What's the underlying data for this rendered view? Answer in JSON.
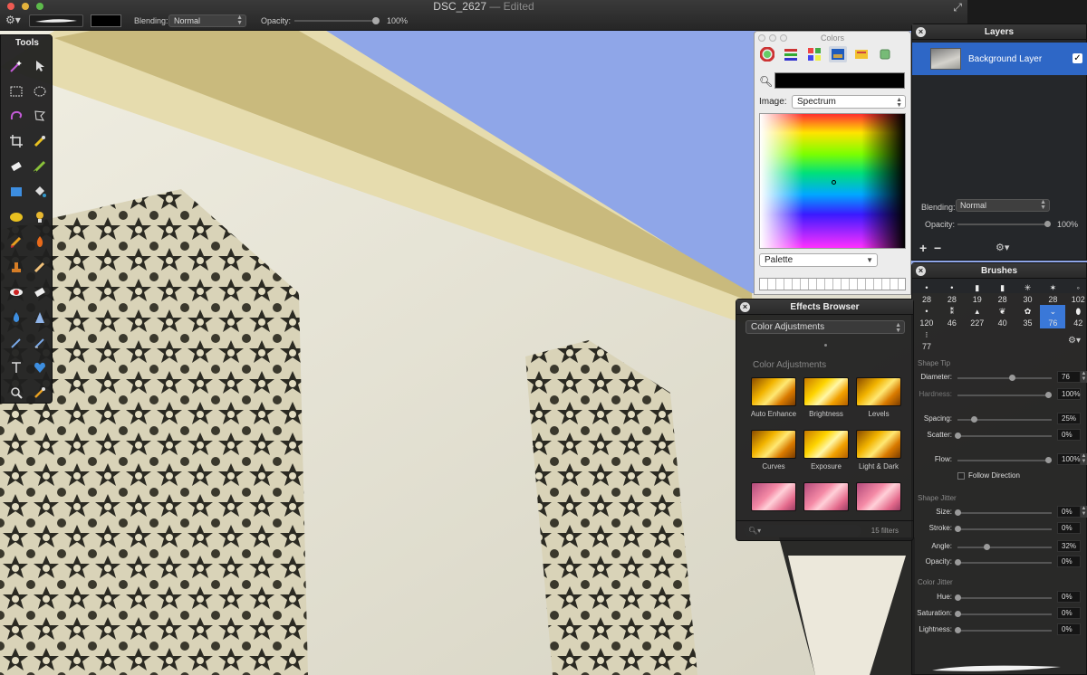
{
  "window": {
    "title": "DSC_2627",
    "edited": "— Edited"
  },
  "options_bar": {
    "blending_label": "Blending:",
    "blending_value": "Normal",
    "opacity_label": "Opacity:",
    "opacity_value": "100%"
  },
  "tools": {
    "title": "Tools",
    "items": [
      "magic-wand",
      "arrow",
      "rect-select",
      "ellipse-select",
      "lasso",
      "poly-lasso",
      "crop",
      "eyedropper",
      "eraser",
      "brush",
      "rectangle",
      "paint-bucket",
      "ellipse",
      "clone-stamp",
      "smudge",
      "burn",
      "stamp",
      "pencil",
      "red-eye",
      "eraser-2",
      "drop",
      "sharpen",
      "pen",
      "pen-edit",
      "text",
      "shape-heart",
      "zoom",
      "color-picker"
    ]
  },
  "colors": {
    "title": "Colors",
    "image_label": "Image:",
    "image_value": "Spectrum",
    "palette_value": "Palette"
  },
  "layers": {
    "title": "Layers",
    "layer_name": "Background Layer",
    "blending_label": "Blending:",
    "blending_value": "Normal",
    "opacity_label": "Opacity:",
    "opacity_value": "100%"
  },
  "brushes": {
    "title": "Brushes",
    "sizes": [
      "28",
      "28",
      "19",
      "28",
      "30",
      "28",
      "102",
      "120",
      "46",
      "227",
      "40",
      "35",
      "76",
      "42",
      "77"
    ],
    "selected_index": 12,
    "shape_tip_label": "Shape Tip",
    "shape_jitter_label": "Shape Jitter",
    "color_jitter_label": "Color Jitter",
    "follow_direction": "Follow Direction",
    "params": [
      {
        "label": "Diameter:",
        "value": "76",
        "level": 0.6,
        "dim": false
      },
      {
        "label": "Hardness:",
        "value": "100%",
        "level": 1.0,
        "dim": true
      },
      {
        "label": "Spacing:",
        "value": "25%",
        "level": 0.18,
        "dim": false
      },
      {
        "label": "Scatter:",
        "value": "0%",
        "level": 0.0,
        "dim": false
      },
      {
        "label": "Flow:",
        "value": "100%",
        "level": 1.0,
        "dim": false
      },
      {
        "label": "Size:",
        "value": "0%",
        "level": 0.0,
        "dim": false
      },
      {
        "label": "Stroke:",
        "value": "0%",
        "level": 0.0,
        "dim": false
      },
      {
        "label": "Angle:",
        "value": "32%",
        "level": 0.32,
        "dim": false
      },
      {
        "label": "Opacity:",
        "value": "0%",
        "level": 0.0,
        "dim": false
      },
      {
        "label": "Hue:",
        "value": "0%",
        "level": 0.0,
        "dim": false
      },
      {
        "label": "Saturation:",
        "value": "0%",
        "level": 0.0,
        "dim": false
      },
      {
        "label": "Lightness:",
        "value": "0%",
        "level": 0.0,
        "dim": false
      }
    ]
  },
  "effects": {
    "title": "Effects Browser",
    "category": "Color Adjustments",
    "section": "Color Adjustments",
    "items": [
      "Auto Enhance",
      "Brightness",
      "Levels",
      "Curves",
      "Exposure",
      "Light & Dark",
      "",
      "",
      ""
    ],
    "count": "15 filters"
  },
  "colors_theme": {
    "selection_blue": "#2e67c6",
    "sky_blue": "#8fa6e8"
  }
}
